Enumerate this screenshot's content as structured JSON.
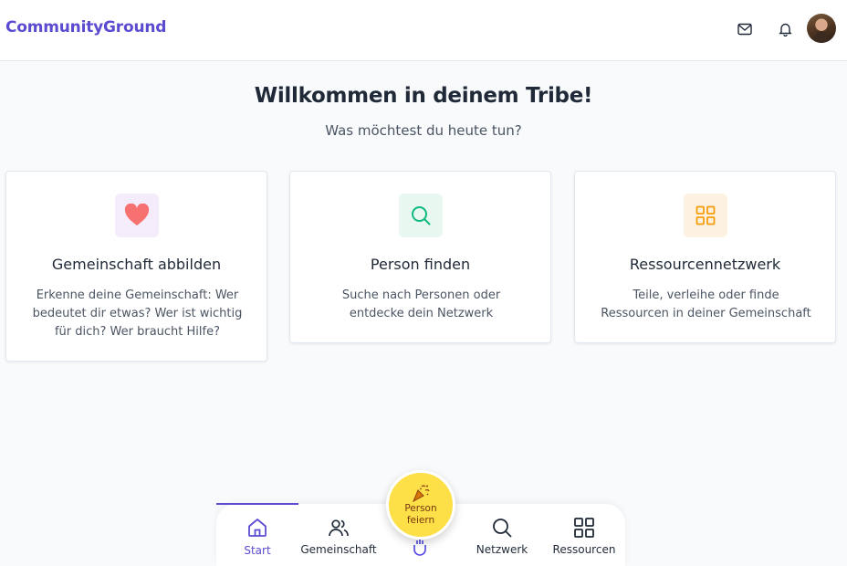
{
  "header": {
    "brand": "CommunityGround",
    "icons": [
      "mail-icon",
      "bell-icon"
    ],
    "accent": "#5b4bd1"
  },
  "hero": {
    "title": "Willkommen in deinem Tribe!",
    "subtitle": "Was möchtest du heute tun?"
  },
  "cards": [
    {
      "title": "Gemeinschaft abbilden",
      "description": "Erkenne deine Gemeinschaft: Wer bedeutet dir etwas? Wer ist wichtig für dich? Wer braucht Hilfe?",
      "icon": "heart-icon",
      "icon_bg": "#f5ecfb",
      "icon_color": "#f87171"
    },
    {
      "title": "Person finden",
      "description": "Suche nach Personen oder entdecke dein Netzwerk",
      "icon": "search-icon",
      "icon_bg": "#e8f7f0",
      "icon_color": "#10b981"
    },
    {
      "title": "Ressourcennetzwerk",
      "description": "Teile, verleihe oder finde Ressourcen in deiner Gemeinschaft",
      "icon": "grid-icon",
      "icon_bg": "#fdf1e1",
      "icon_color": "#f59e0b"
    }
  ],
  "bottom_nav": {
    "items": [
      {
        "label": "Start",
        "icon": "home-icon",
        "active": true
      },
      {
        "label": "Gemeinschaft",
        "icon": "users-icon",
        "active": false
      },
      {
        "label": "Netzwerk",
        "icon": "search-icon",
        "active": false
      },
      {
        "label": "Ressourcen",
        "icon": "grid-icon",
        "active": false
      }
    ],
    "fab": {
      "label": "Person feiern",
      "icon": "party-popper-icon",
      "secondary_icon": "waving-hand-icon",
      "color": "#facc15"
    }
  }
}
